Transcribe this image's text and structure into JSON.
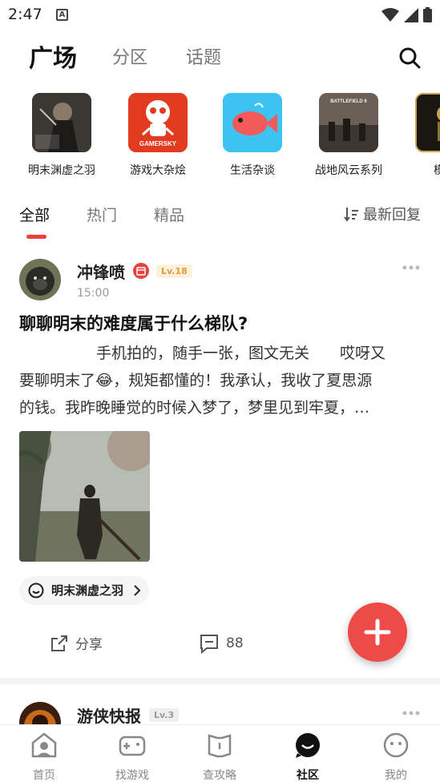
{
  "status_bar": {
    "time": "2:47",
    "notification_icon": "A"
  },
  "top_nav": {
    "tabs": [
      {
        "label": "广场",
        "active": true
      },
      {
        "label": "分区",
        "active": false
      },
      {
        "label": "话题",
        "active": false
      }
    ],
    "search_icon": "search-icon"
  },
  "zones": [
    {
      "label": "明末渊虚之羽",
      "icon": "wuchang-game-icon"
    },
    {
      "label": "游戏大杂烩",
      "icon": "gamersky-robot-icon"
    },
    {
      "label": "生活杂谈",
      "icon": "fish-icon"
    },
    {
      "label": "战地风云系列",
      "icon": "battlefield-icon"
    },
    {
      "label": "模玩",
      "icon": "model-toy-icon"
    }
  ],
  "zone_logo_texts": {
    "gamersky": "GAMERSKY",
    "battlefield": "BATTLEFIELD 6"
  },
  "filter": {
    "tabs": [
      {
        "label": "全部",
        "active": true
      },
      {
        "label": "热门",
        "active": false
      },
      {
        "label": "精品",
        "active": false
      }
    ],
    "sort_label": "最新回复"
  },
  "posts": [
    {
      "author": "冲锋喷",
      "level": "Lv.18",
      "time": "15:00",
      "title": "聊聊明末的难度属于什么梯队?",
      "body_line1": "手机拍的，随手一张，图文无关　　哎呀又",
      "body_line2": "要聊明末了😂，规矩都懂的！我承认，我收了夏思源",
      "body_line3": "的钱。我昨晚睡觉的时候入梦了，梦里见到牢夏，…",
      "tag": "明末渊虚之羽",
      "share_label": "分享",
      "comment_count": "88"
    },
    {
      "author": "游侠快报",
      "level": "Lv.3"
    }
  ],
  "bottom_nav": [
    {
      "label": "首页",
      "icon": "home-icon",
      "active": false
    },
    {
      "label": "找游戏",
      "icon": "gamepad-icon",
      "active": false
    },
    {
      "label": "查攻略",
      "icon": "guide-book-icon",
      "active": false
    },
    {
      "label": "社区",
      "icon": "community-icon",
      "active": true
    },
    {
      "label": "我的",
      "icon": "profile-icon",
      "active": false
    }
  ],
  "colors": {
    "accent": "#e8413e",
    "fab": "#ee4a47",
    "level_badge": "#e09a3a"
  }
}
